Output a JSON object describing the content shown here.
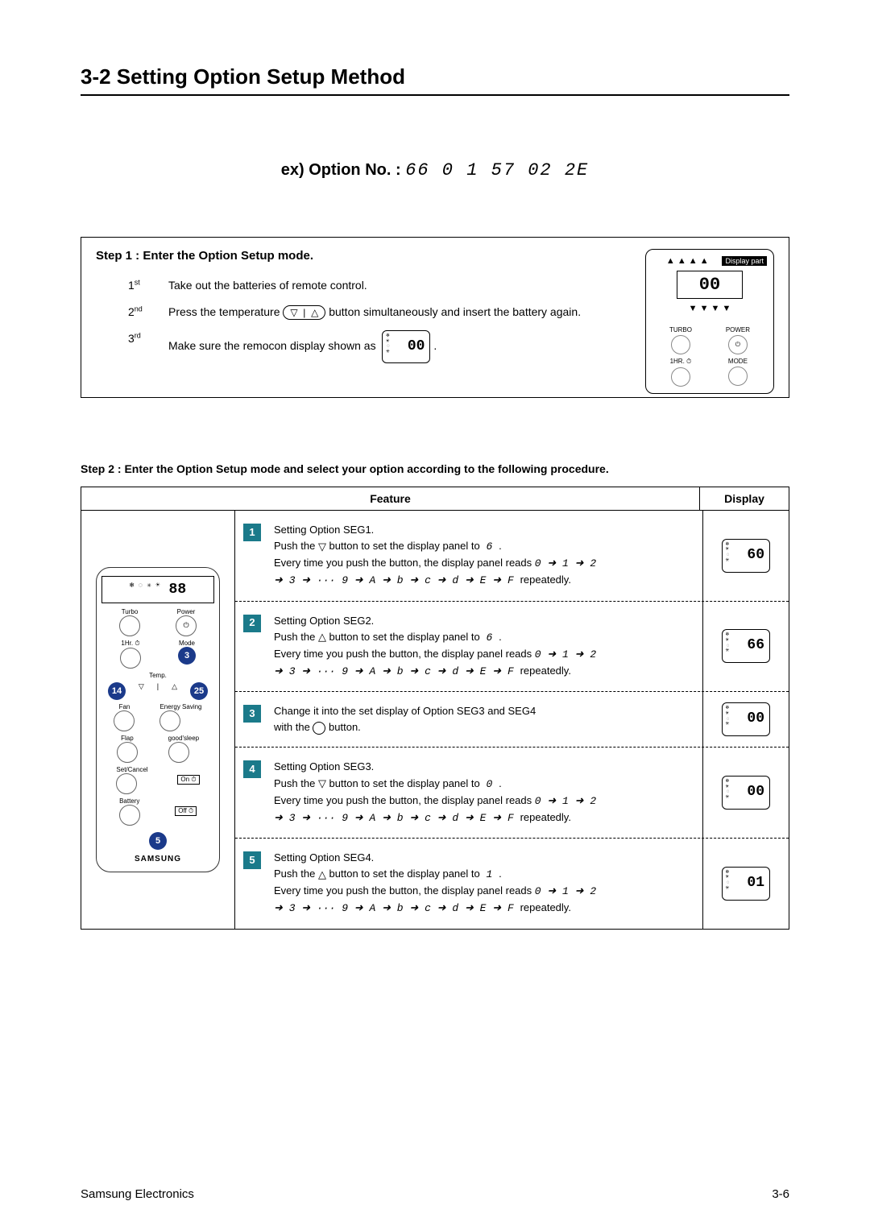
{
  "title": "3-2 Setting Option Setup Method",
  "example": {
    "label": "ex) Option No. :",
    "value": "66 0 1 57 02 2E"
  },
  "step1": {
    "heading": "Step 1 : Enter the Option Setup mode.",
    "items": [
      {
        "ord": "1",
        "suf": "st",
        "text_a": "Take out the batteries of remote control."
      },
      {
        "ord": "2",
        "suf": "nd",
        "text_a": "Press the temperature",
        "text_b": "button simultaneously and insert the battery again."
      },
      {
        "ord": "3",
        "suf": "rd",
        "text_a": "Make sure the remocon display shown as",
        "disp": "00",
        "text_b": "."
      }
    ],
    "remote_tag": "Display part",
    "remote_lcd": "00",
    "remote_btns": [
      {
        "top": "TURBO",
        "bot": "1HR. ⏱"
      },
      {
        "top": "POWER",
        "bot": "MODE"
      }
    ]
  },
  "step2": {
    "heading": "Step 2 : Enter the Option Setup mode and select your option according to the following procedure.",
    "col_feature": "Feature",
    "col_display": "Display",
    "remote": {
      "lcd": "88",
      "turbo": "Turbo",
      "power": "Power",
      "hr": "1Hr. ⏱",
      "mode": "Mode",
      "temp": "Temp.",
      "fan": "Fan",
      "energy": "Energy Saving",
      "flap": "Flap",
      "sleep": "good'sleep",
      "set": "Set/Cancel",
      "on": "On ⏱",
      "off": "Off ⏱",
      "batt": "Battery",
      "brand": "SAMSUNG",
      "n3": "3",
      "n14": "14",
      "n25": "25",
      "n5": "5"
    },
    "sequence_tail": "➜ 3 ➜ ··· 9 ➜ A ➜ b ➜ c ➜ d ➜ E ➜ F",
    "reads_prefix": "Every time you push the button, the display panel reads",
    "reads_seq": "0 ➜ 1 ➜ 2",
    "repeatedly": "repeatedly.",
    "segs": [
      {
        "n": "1",
        "t1": "Setting Option SEG1.",
        "t2a": "Push the",
        "btn": "down",
        "t2b": "button to set the display panel to",
        "target": "6",
        "t2c": ".",
        "disp": "60"
      },
      {
        "n": "2",
        "t1": "Setting Option SEG2.",
        "t2a": "Push the",
        "btn": "up",
        "t2b": "button to set the display panel to",
        "target": "6",
        "t2c": ".",
        "disp": "66"
      },
      {
        "n": "3",
        "t1": "Change it into the set display of Option SEG3 and SEG4",
        "t2a": "with the",
        "btn": "mode",
        "t2b": "button.",
        "no_seq": true,
        "disp": "00"
      },
      {
        "n": "4",
        "t1": "Setting Option SEG3.",
        "t2a": "Push the",
        "btn": "down",
        "t2b": "button to set the display panel to",
        "target": "0",
        "t2c": ".",
        "disp": "00"
      },
      {
        "n": "5",
        "t1": "Setting Option SEG4.",
        "t2a": "Push the",
        "btn": "up",
        "t2b": "button to set the display panel to",
        "target": "1",
        "t2c": ".",
        "disp": "01"
      }
    ]
  },
  "footer": {
    "left": "Samsung Electronics",
    "right": "3-6"
  }
}
